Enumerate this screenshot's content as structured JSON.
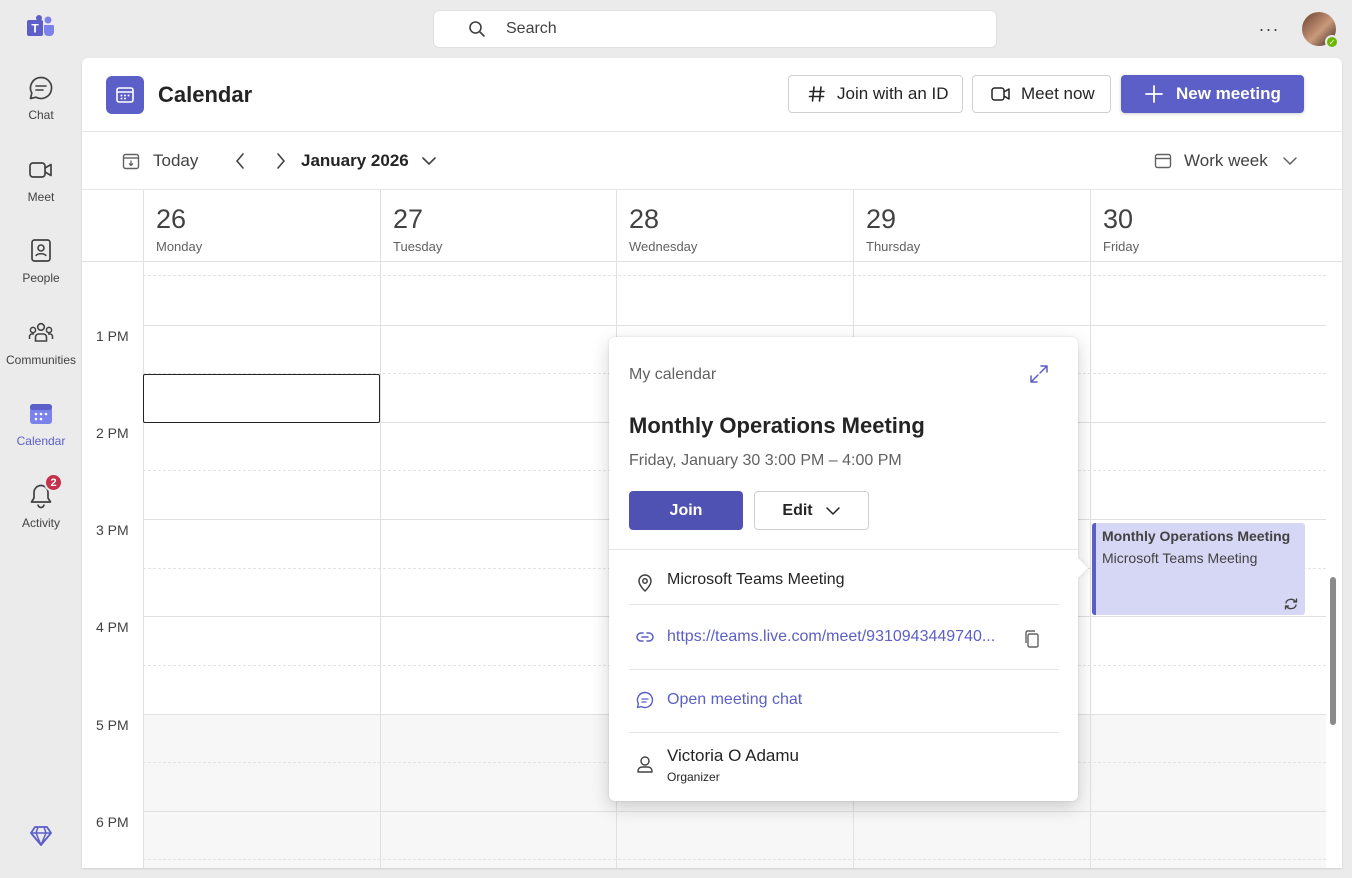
{
  "rail": {
    "items": [
      {
        "label": "Chat"
      },
      {
        "label": "Meet"
      },
      {
        "label": "People"
      },
      {
        "label": "Communities"
      },
      {
        "label": "Calendar"
      },
      {
        "label": "Activity",
        "badge": "2"
      }
    ]
  },
  "search": {
    "placeholder": "Search"
  },
  "app": {
    "title": "Calendar"
  },
  "header": {
    "join_id": "Join with an ID",
    "meet_now": "Meet now",
    "new_meeting": "New meeting"
  },
  "toolbar": {
    "today": "Today",
    "month": "January 2026",
    "view": "Work week"
  },
  "days": [
    {
      "num": "26",
      "name": "Monday"
    },
    {
      "num": "27",
      "name": "Tuesday"
    },
    {
      "num": "28",
      "name": "Wednesday"
    },
    {
      "num": "29",
      "name": "Thursday"
    },
    {
      "num": "30",
      "name": "Friday"
    }
  ],
  "times": [
    "1 PM",
    "2 PM",
    "3 PM",
    "4 PM",
    "5 PM",
    "6 PM"
  ],
  "event": {
    "title": "Monthly Operations Meeting",
    "subtitle": "Microsoft Teams Meeting"
  },
  "popover": {
    "calendar": "My calendar",
    "title": "Monthly Operations Meeting",
    "when": "Friday, January 30 3:00 PM – 4:00 PM",
    "join": "Join",
    "edit": "Edit",
    "location": "Microsoft Teams Meeting",
    "link": "https://teams.live.com/meet/9310943449740...",
    "chat": "Open meeting chat",
    "organizer_name": "Victoria O Adamu",
    "organizer_role": "Organizer"
  },
  "colors": {
    "accent": "#5b5fc7",
    "event_bg": "#d6d7f5",
    "join_bg": "#4f52b2",
    "badge": "#c4314b"
  }
}
